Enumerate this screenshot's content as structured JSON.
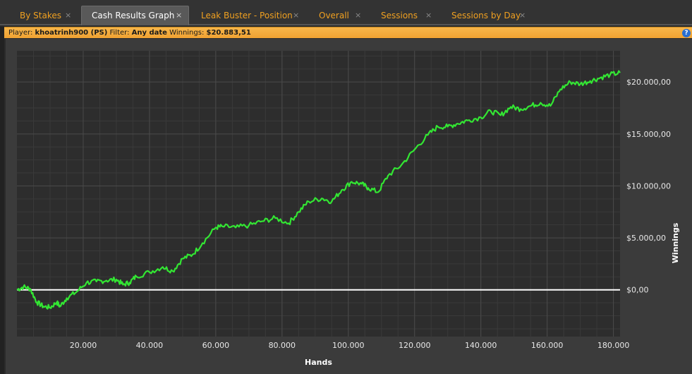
{
  "tabs": [
    {
      "label": "By Stakes",
      "active": false
    },
    {
      "label": "Cash Results Graph",
      "active": true
    },
    {
      "label": "Leak Buster - Position",
      "active": false
    },
    {
      "label": "Overall",
      "active": false
    },
    {
      "label": "Sessions",
      "active": false
    },
    {
      "label": "Sessions by Day",
      "active": false
    }
  ],
  "tab_close_glyph": "×",
  "infobar": {
    "player_label": "Player:",
    "player_value": "khoatrinh900 (PS)",
    "filter_label": "Filter:",
    "filter_value": "Any date",
    "winnings_label": "Winnings:",
    "winnings_value": "$20.883,51",
    "help_icon": "?"
  },
  "colors": {
    "line": "#33e633",
    "zero_line": "#ffffff",
    "plot_bg": "#2d2d2d",
    "grid": "#4a4a4a",
    "accent": "#f0a020"
  },
  "chart_data": {
    "type": "line",
    "xlabel": "Hands",
    "ylabel": "Winnings",
    "xlim": [
      0,
      182000
    ],
    "ylim": [
      -4500,
      23000
    ],
    "x_ticks": [
      20000,
      40000,
      60000,
      80000,
      100000,
      120000,
      140000,
      160000,
      180000
    ],
    "x_tick_labels": [
      "20.000",
      "40.000",
      "60.000",
      "80.000",
      "100.000",
      "120.000",
      "140.000",
      "160.000",
      "180.000"
    ],
    "y_ticks": [
      0,
      5000,
      10000,
      15000,
      20000
    ],
    "y_tick_labels": [
      "$0,00",
      "$5.000,00",
      "$10.000,00",
      "$15.000,00",
      "$20.000,00"
    ],
    "grid": true,
    "series": [
      {
        "x": [
          0,
          2000,
          4000,
          6000,
          8000,
          10000,
          12000,
          13000,
          15000,
          18000,
          21000,
          24000,
          27000,
          30000,
          32000,
          34000,
          36000,
          40000,
          44000,
          47000,
          50000,
          53000,
          56000,
          60000,
          62000,
          66000,
          70000,
          74000,
          78000,
          82000,
          85000,
          88000,
          92000,
          95000,
          98000,
          101000,
          104000,
          106000,
          109000,
          112000,
          116000,
          120000,
          124000,
          127000,
          130000,
          133000,
          136000,
          140000,
          143000,
          146000,
          149000,
          152000,
          155000,
          158000,
          161000,
          164000,
          167000,
          170000,
          173000,
          176000,
          179000,
          182000
        ],
        "y": [
          0,
          300,
          100,
          -1200,
          -1600,
          -1700,
          -1200,
          -1600,
          -800,
          -200,
          700,
          800,
          900,
          1000,
          500,
          700,
          1300,
          1700,
          2200,
          1800,
          3000,
          3400,
          4500,
          6000,
          6100,
          6000,
          6200,
          6600,
          6900,
          6400,
          7500,
          8500,
          8800,
          8500,
          9600,
          10400,
          10200,
          9800,
          9400,
          11000,
          12000,
          13500,
          14900,
          15700,
          15700,
          16000,
          16300,
          16600,
          17200,
          16800,
          17600,
          17400,
          17700,
          18000,
          17700,
          19300,
          20000,
          19800,
          20100,
          20400,
          20700,
          20884
        ]
      }
    ]
  }
}
